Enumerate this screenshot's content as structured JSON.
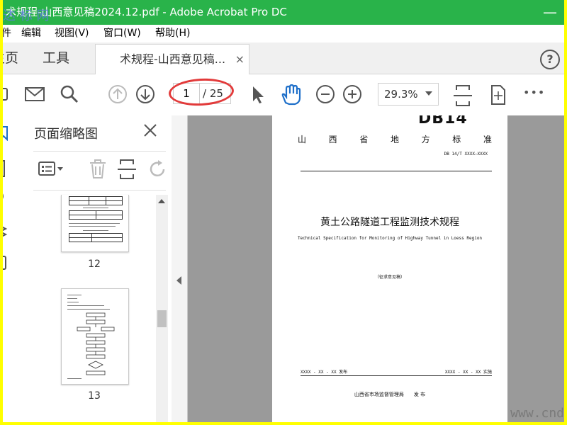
{
  "window": {
    "title": "术规程-山西意见稿2024.12.pdf - Adobe Acrobat Pro DC",
    "watermark": "达 标 网"
  },
  "menu": [
    "件",
    "编辑",
    "视图(V)",
    "窗口(W)",
    "帮助(H)"
  ],
  "tabs": {
    "home": "主页",
    "tools": "工具",
    "document": "术规程-山西意见稿...",
    "close": "×",
    "help": "?"
  },
  "toolbar": {
    "page_current": "1",
    "page_total": "/ 25",
    "zoom": "29.3%",
    "more": "•••"
  },
  "panel": {
    "title": "页面缩略图",
    "thumbnails": [
      {
        "page": "12"
      },
      {
        "page": "13"
      }
    ]
  },
  "document_page": {
    "header_code": "DB14",
    "standard_type": [
      "山",
      "西",
      "省",
      "地",
      "方",
      "标",
      "准"
    ],
    "doc_number": "DB 14/T XXXX—XXXX",
    "title_cn": "黄土公路隧道工程监测技术规程",
    "title_en": "Technical Specification for Monitoring of Highway Tunnel in Loess Region",
    "draft_note": "（征求意见稿）",
    "publish_date": "XXXX - XX - XX 发布",
    "implement_date": "XXXX - XX - XX 实施",
    "issuer": "山西省市场监督管理局　　发 布"
  },
  "corner_watermark": "www.cnd",
  "colors": {
    "titlebar": "#29b34a",
    "highlight_circle": "#e23a3a",
    "frame": "#ffff00",
    "canvas": "#9a9a9a"
  }
}
